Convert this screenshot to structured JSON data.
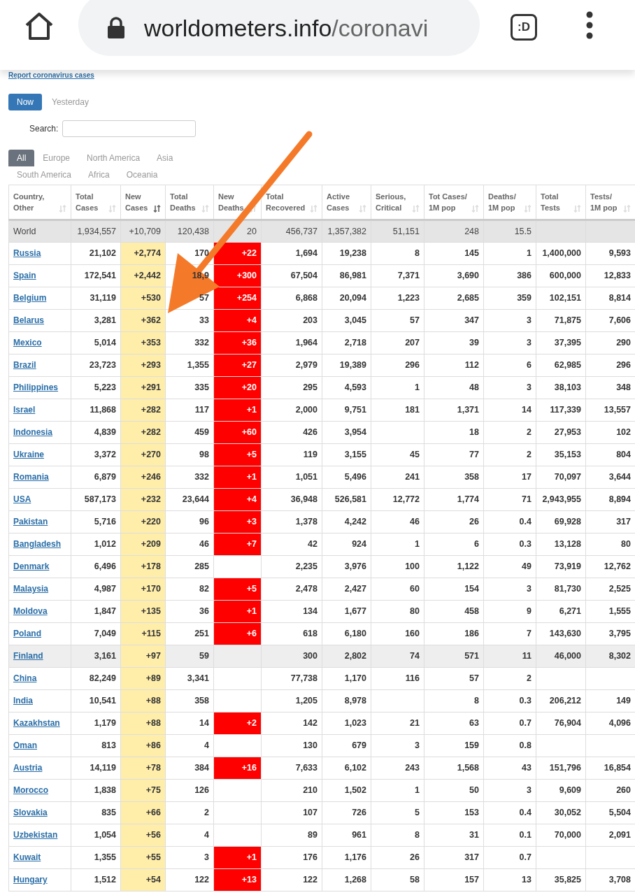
{
  "browser": {
    "url_host": "worldometers.info",
    "url_path": "/coronavi",
    "tab_count": ":D"
  },
  "report_link": "Report coronavirus cases",
  "day_tabs": [
    {
      "label": "Now",
      "selected": true
    },
    {
      "label": "Yesterday",
      "selected": false
    }
  ],
  "search": {
    "label": "Search:"
  },
  "region_tabs": [
    {
      "label": "All",
      "selected": true
    },
    {
      "label": "Europe",
      "selected": false
    },
    {
      "label": "North America",
      "selected": false
    },
    {
      "label": "Asia",
      "selected": false
    },
    {
      "label": "South America",
      "selected": false
    },
    {
      "label": "Africa",
      "selected": false
    },
    {
      "label": "Oceania",
      "selected": false
    }
  ],
  "table": {
    "columns": [
      {
        "label": "Country,\nOther",
        "sorted": false
      },
      {
        "label": "Total\nCases",
        "sorted": false
      },
      {
        "label": "New\nCases",
        "sorted": true
      },
      {
        "label": "Total\nDeaths",
        "sorted": false
      },
      {
        "label": "New\nDeaths",
        "sorted": false
      },
      {
        "label": "Total\nRecovered",
        "sorted": false
      },
      {
        "label": "Active\nCases",
        "sorted": false
      },
      {
        "label": "Serious,\nCritical",
        "sorted": false
      },
      {
        "label": "Tot Cases/\n1M pop",
        "sorted": false
      },
      {
        "label": "Deaths/\n1M pop",
        "sorted": false
      },
      {
        "label": "Total\nTests",
        "sorted": false
      },
      {
        "label": "Tests/\n1M pop",
        "sorted": false
      }
    ],
    "total_row": [
      "World",
      "1,934,557",
      "+10,709",
      "120,438",
      "20",
      "456,737",
      "1,357,382",
      "51,151",
      "248",
      "15.5"
    ],
    "rows": [
      {
        "highlighted": false,
        "cells": [
          "Russia",
          "21,102",
          "+2,774",
          "170",
          "+22",
          "1,694",
          "19,238",
          "8",
          "145",
          "1",
          "1,400,000",
          "9,593"
        ]
      },
      {
        "highlighted": false,
        "cells": [
          "Spain",
          "172,541",
          "+2,442",
          "18,9",
          "+300",
          "67,504",
          "86,981",
          "7,371",
          "3,690",
          "386",
          "600,000",
          "12,833"
        ]
      },
      {
        "highlighted": false,
        "cells": [
          "Belgium",
          "31,119",
          "+530",
          "57",
          "+254",
          "6,868",
          "20,094",
          "1,223",
          "2,685",
          "359",
          "102,151",
          "8,814"
        ]
      },
      {
        "highlighted": false,
        "cells": [
          "Belarus",
          "3,281",
          "+362",
          "33",
          "+4",
          "203",
          "3,045",
          "57",
          "347",
          "3",
          "71,875",
          "7,606"
        ]
      },
      {
        "highlighted": false,
        "cells": [
          "Mexico",
          "5,014",
          "+353",
          "332",
          "+36",
          "1,964",
          "2,718",
          "207",
          "39",
          "3",
          "37,395",
          "290"
        ]
      },
      {
        "highlighted": false,
        "cells": [
          "Brazil",
          "23,723",
          "+293",
          "1,355",
          "+27",
          "2,979",
          "19,389",
          "296",
          "112",
          "6",
          "62,985",
          "296"
        ]
      },
      {
        "highlighted": false,
        "cells": [
          "Philippines",
          "5,223",
          "+291",
          "335",
          "+20",
          "295",
          "4,593",
          "1",
          "48",
          "3",
          "38,103",
          "348"
        ]
      },
      {
        "highlighted": false,
        "cells": [
          "Israel",
          "11,868",
          "+282",
          "117",
          "+1",
          "2,000",
          "9,751",
          "181",
          "1,371",
          "14",
          "117,339",
          "13,557"
        ]
      },
      {
        "highlighted": false,
        "cells": [
          "Indonesia",
          "4,839",
          "+282",
          "459",
          "+60",
          "426",
          "3,954",
          null,
          "18",
          "2",
          "27,953",
          "102"
        ]
      },
      {
        "highlighted": false,
        "cells": [
          "Ukraine",
          "3,372",
          "+270",
          "98",
          "+5",
          "119",
          "3,155",
          "45",
          "77",
          "2",
          "35,153",
          "804"
        ]
      },
      {
        "highlighted": false,
        "cells": [
          "Romania",
          "6,879",
          "+246",
          "332",
          "+1",
          "1,051",
          "5,496",
          "241",
          "358",
          "17",
          "70,097",
          "3,644"
        ]
      },
      {
        "highlighted": false,
        "cells": [
          "USA",
          "587,173",
          "+232",
          "23,644",
          "+4",
          "36,948",
          "526,581",
          "12,772",
          "1,774",
          "71",
          "2,943,955",
          "8,894"
        ]
      },
      {
        "highlighted": false,
        "cells": [
          "Pakistan",
          "5,716",
          "+220",
          "96",
          "+3",
          "1,378",
          "4,242",
          "46",
          "26",
          "0.4",
          "69,928",
          "317"
        ]
      },
      {
        "highlighted": false,
        "cells": [
          "Bangladesh",
          "1,012",
          "+209",
          "46",
          "+7",
          "42",
          "924",
          "1",
          "6",
          "0.3",
          "13,128",
          "80"
        ]
      },
      {
        "highlighted": false,
        "cells": [
          "Denmark",
          "6,496",
          "+178",
          "285",
          null,
          "2,235",
          "3,976",
          "100",
          "1,122",
          "49",
          "73,919",
          "12,762"
        ]
      },
      {
        "highlighted": false,
        "cells": [
          "Malaysia",
          "4,987",
          "+170",
          "82",
          "+5",
          "2,478",
          "2,427",
          "60",
          "154",
          "3",
          "81,730",
          "2,525"
        ]
      },
      {
        "highlighted": false,
        "cells": [
          "Moldova",
          "1,847",
          "+135",
          "36",
          "+1",
          "134",
          "1,677",
          "80",
          "458",
          "9",
          "6,271",
          "1,555"
        ]
      },
      {
        "highlighted": false,
        "cells": [
          "Poland",
          "7,049",
          "+115",
          "251",
          "+6",
          "618",
          "6,180",
          "160",
          "186",
          "7",
          "143,630",
          "3,795"
        ]
      },
      {
        "highlighted": true,
        "cells": [
          "Finland",
          "3,161",
          "+97",
          "59",
          null,
          "300",
          "2,802",
          "74",
          "571",
          "11",
          "46,000",
          "8,302"
        ]
      },
      {
        "highlighted": false,
        "cells": [
          "China",
          "82,249",
          "+89",
          "3,341",
          null,
          "77,738",
          "1,170",
          "116",
          "57",
          "2"
        ]
      },
      {
        "highlighted": false,
        "cells": [
          "India",
          "10,541",
          "+88",
          "358",
          null,
          "1,205",
          "8,978",
          null,
          "8",
          "0.3",
          "206,212",
          "149"
        ]
      },
      {
        "highlighted": false,
        "cells": [
          "Kazakhstan",
          "1,179",
          "+88",
          "14",
          "+2",
          "142",
          "1,023",
          "21",
          "63",
          "0.7",
          "76,904",
          "4,096"
        ]
      },
      {
        "highlighted": false,
        "cells": [
          "Oman",
          "813",
          "+86",
          "4",
          null,
          "130",
          "679",
          "3",
          "159",
          "0.8"
        ]
      },
      {
        "highlighted": false,
        "cells": [
          "Austria",
          "14,119",
          "+78",
          "384",
          "+16",
          "7,633",
          "6,102",
          "243",
          "1,568",
          "43",
          "151,796",
          "16,854"
        ]
      },
      {
        "highlighted": false,
        "cells": [
          "Morocco",
          "1,838",
          "+75",
          "126",
          null,
          "210",
          "1,502",
          "1",
          "50",
          "3",
          "9,609",
          "260"
        ]
      },
      {
        "highlighted": false,
        "cells": [
          "Slovakia",
          "835",
          "+66",
          "2",
          null,
          "107",
          "726",
          "5",
          "153",
          "0.4",
          "30,052",
          "5,504"
        ]
      },
      {
        "highlighted": false,
        "cells": [
          "Uzbekistan",
          "1,054",
          "+56",
          "4",
          null,
          "89",
          "961",
          "8",
          "31",
          "0.1",
          "70,000",
          "2,091"
        ]
      },
      {
        "highlighted": false,
        "cells": [
          "Kuwait",
          "1,355",
          "+55",
          "3",
          "+1",
          "176",
          "1,176",
          "26",
          "317",
          "0.7"
        ]
      },
      {
        "highlighted": false,
        "cells": [
          "Hungary",
          "1,512",
          "+54",
          "122",
          "+13",
          "122",
          "1,268",
          "58",
          "157",
          "13",
          "35,825",
          "3,708"
        ]
      }
    ]
  }
}
